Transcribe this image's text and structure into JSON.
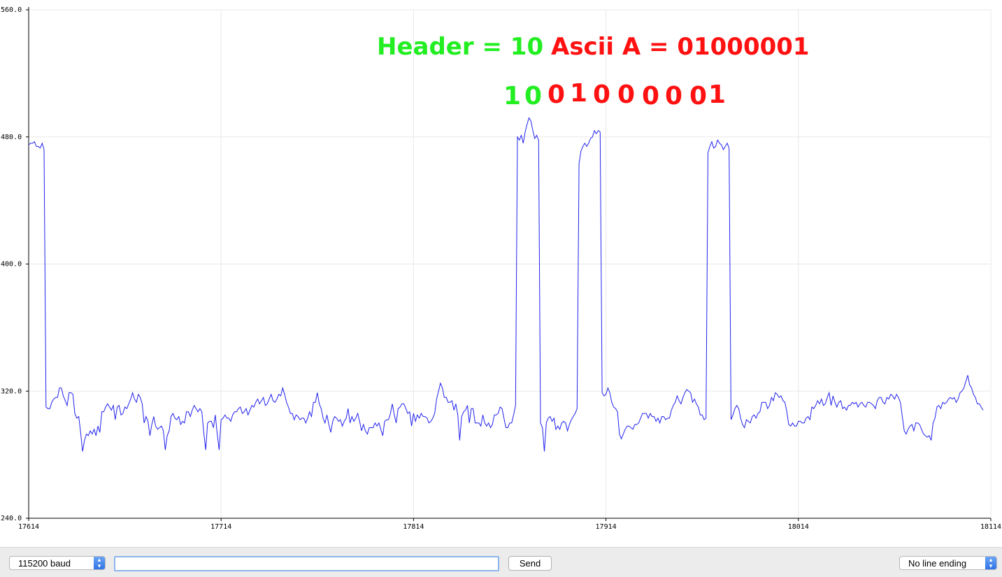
{
  "annotations": {
    "header_label": "Header = 10",
    "ascii_label": "Ascii A = 01000001",
    "header_color": "#22ee22",
    "data_color": "#ff1111",
    "bits": [
      {
        "text": "1",
        "color": "#22ee22"
      },
      {
        "text": "0",
        "color": "#22ee22"
      },
      {
        "text": "0",
        "color": "#ff1111"
      },
      {
        "text": "1",
        "color": "#ff1111"
      },
      {
        "text": "0",
        "color": "#ff1111"
      },
      {
        "text": "0",
        "color": "#ff1111"
      },
      {
        "text": "0",
        "color": "#ff1111"
      },
      {
        "text": "0",
        "color": "#ff1111"
      },
      {
        "text": "0",
        "color": "#ff1111"
      },
      {
        "text": "1",
        "color": "#ff1111"
      }
    ]
  },
  "chart_data": {
    "type": "line",
    "line_color": "#2222ee",
    "grid": true,
    "xlim": [
      17614,
      18114
    ],
    "ylim": [
      240,
      560
    ],
    "x_ticks": [
      "17614",
      "17714",
      "17814",
      "17914",
      "18014",
      "18114"
    ],
    "y_ticks": [
      "560.0",
      "480.0",
      "400.0",
      "320.0",
      "240.0"
    ],
    "series": [
      {
        "x_start": 17614,
        "x_step": 1,
        "values": [
          475,
          476,
          476,
          477,
          474,
          474,
          473,
          476,
          472,
          310,
          309,
          309,
          313,
          315,
          316,
          316,
          322,
          322,
          317,
          314,
          311,
          319,
          319,
          318,
          306,
          303,
          304,
          294,
          282,
          289,
          293,
          292,
          295,
          293,
          296,
          292,
          298,
          294,
          307,
          307,
          310,
          312,
          310,
          308,
          311,
          302,
          310,
          311,
          305,
          306,
          310,
          309,
          312,
          315,
          319,
          315,
          313,
          318,
          316,
          312,
          300,
          304,
          301,
          292,
          299,
          304,
          298,
          296,
          297,
          298,
          295,
          283,
          292,
          295,
          304,
          306,
          303,
          302,
          304,
          299,
          301,
          300,
          307,
          307,
          304,
          308,
          311,
          309,
          307,
          309,
          307,
          294,
          283,
          300,
          301,
          301,
          297,
          305,
          293,
          283,
          302,
          303,
          305,
          303,
          303,
          301,
          305,
          307,
          307,
          309,
          310,
          306,
          307,
          309,
          305,
          308,
          311,
          310,
          313,
          315,
          312,
          314,
          316,
          311,
          312,
          315,
          318,
          314,
          313,
          315,
          318,
          317,
          322,
          318,
          313,
          310,
          306,
          306,
          302,
          305,
          304,
          302,
          303,
          303,
          300,
          303,
          307,
          304,
          313,
          313,
          319,
          312,
          309,
          303,
          300,
          305,
          299,
          294,
          301,
          304,
          303,
          301,
          302,
          298,
          301,
          303,
          309,
          300,
          304,
          301,
          303,
          306,
          301,
          295,
          299,
          295,
          293,
          297,
          297,
          297,
          300,
          298,
          300,
          296,
          292,
          301,
          302,
          302,
          306,
          312,
          305,
          300,
          309,
          310,
          312,
          312,
          309,
          306,
          307,
          298,
          306,
          301,
          305,
          303,
          306,
          304,
          304,
          303,
          300,
          301,
          303,
          306,
          315,
          320,
          325,
          322,
          316,
          316,
          313,
          313,
          314,
          308,
          312,
          305,
          289,
          304,
          307,
          308,
          311,
          300,
          309,
          309,
          300,
          300,
          300,
          298,
          305,
          300,
          298,
          300,
          297,
          299,
          305,
          305,
          306,
          310,
          309,
          303,
          297,
          297,
          300,
          300,
          305,
          311,
          316,
          321,
          324,
          322,
          309,
          311,
          316,
          310,
          307,
          300,
          303,
          305,
          300,
          297,
          282,
          300,
          303,
          304,
          301,
          303,
          296,
          298,
          296,
          300,
          301,
          300,
          295,
          299,
          302,
          304,
          306,
          309,
          315,
          317,
          312,
          310,
          313,
          312,
          316,
          310,
          312,
          316,
          318,
          323,
          319,
          317,
          318,
          322,
          319,
          313,
          310,
          309,
          307,
          293,
          290,
          293,
          296,
          298,
          298,
          297,
          296,
          299,
          299,
          300,
          303,
          306,
          306,
          306,
          303,
          306,
          304,
          304,
          301,
          303,
          300,
          304,
          304,
          302,
          303,
          303,
          308,
          311,
          313,
          317,
          314,
          312,
          316,
          319,
          321,
          320,
          319,
          313,
          315,
          312,
          310,
          305,
          305,
          302,
          303,
          299,
          305,
          303,
          303,
          307,
          308,
          305,
          302,
          304,
          303,
          298,
          295,
          302,
          305,
          309,
          311,
          309,
          303,
          299,
          297,
          302,
          301,
          300,
          304,
          305,
          303,
          306,
          307,
          313,
          313,
          313,
          309,
          311,
          316,
          314,
          319,
          318,
          316,
          317,
          314,
          313,
          307,
          299,
          298,
          300,
          298,
          298,
          301,
          301,
          300,
          300,
          303,
          304,
          302,
          310,
          309,
          311,
          314,
          312,
          315,
          311,
          312,
          316,
          319,
          311,
          317,
          313,
          310,
          313,
          314,
          309,
          310,
          308,
          311,
          311,
          313,
          312,
          313,
          310,
          312,
          313,
          311,
          310,
          313,
          313,
          312,
          311,
          309,
          314,
          316,
          316,
          313,
          312,
          316,
          315,
          318,
          317,
          315,
          318,
          316,
          313,
          304,
          295,
          293,
          296,
          298,
          299,
          295,
          300,
          300,
          299,
          296,
          293,
          292,
          291,
          292,
          289,
          300,
          303,
          310,
          311,
          309,
          313,
          312,
          313,
          315,
          316,
          315,
          316,
          313,
          315,
          319,
          320,
          322,
          326,
          330,
          324,
          322,
          318,
          316,
          312,
          312,
          310,
          308
        ]
      }
    ],
    "spikes": [
      {
        "x_start": 17868,
        "x_end": 17879,
        "values": [
          480,
          478,
          481,
          476,
          483,
          488,
          492,
          490,
          484,
          479,
          481,
          478
        ]
      },
      {
        "x_start": 17900,
        "x_end": 17911,
        "values": [
          463,
          471,
          474,
          476,
          474,
          476,
          479,
          480,
          484,
          482,
          484,
          483
        ]
      },
      {
        "x_start": 17967,
        "x_end": 17978,
        "values": [
          470,
          474,
          477,
          473,
          474,
          478,
          476,
          475,
          472,
          474,
          476,
          473
        ]
      }
    ]
  },
  "controls": {
    "baud_select": "115200 baud",
    "input_value": "",
    "send_label": "Send",
    "line_ending_select": "No line ending"
  }
}
